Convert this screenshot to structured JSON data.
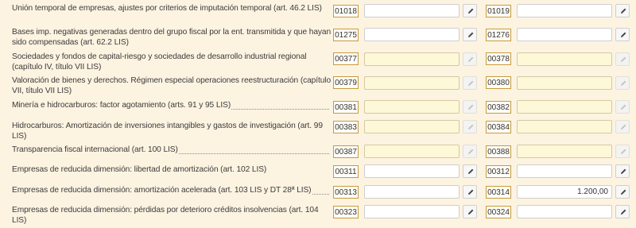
{
  "rows": [
    {
      "label": "Unión temporal de empresas, ajustes por criterios de imputación temporal (art. 46.2 LIS)",
      "code1": "01018",
      "value1": "",
      "code2": "01019",
      "value2": ""
    },
    {
      "label": "Bases imp. negativas generadas dentro del grupo fiscal por la ent. transmitida y que hayan sido compensadas (art. 62.2 LIS)",
      "code1": "01275",
      "value1": "",
      "code2": "01276",
      "value2": ""
    },
    {
      "label": "Sociedades y fondos de capital-riesgo y sociedades de desarrollo industrial regional (capítulo IV, título VII LIS)",
      "code1": "00377",
      "value1": "",
      "code2": "00378",
      "value2": ""
    },
    {
      "label": "Valoración de bienes y derechos. Régimen especial operaciones reestructuración (capítulo VII, título VII LIS)",
      "code1": "00379",
      "value1": "",
      "code2": "00380",
      "value2": ""
    },
    {
      "label": "Minería e hidrocarburos: factor agotamiento (arts. 91 y 95 LIS)",
      "code1": "00381",
      "value1": "",
      "code2": "00382",
      "value2": ""
    },
    {
      "label": "Hidrocarburos: Amortización de inversiones intangibles y gastos de investigación (art. 99 LIS)",
      "code1": "00383",
      "value1": "",
      "code2": "00384",
      "value2": ""
    },
    {
      "label": "Transparencia fiscal internacional (art. 100 LIS)",
      "code1": "00387",
      "value1": "",
      "code2": "00388",
      "value2": ""
    },
    {
      "label": "Empresas de reducida dimensión: libertad de amortización (art. 102 LIS)",
      "code1": "00311",
      "value1": "",
      "code2": "00312",
      "value2": ""
    },
    {
      "label": "Empresas de reducida dimensión: amortización acelerada (art. 103 LIS y DT 28ª LIS)",
      "code1": "00313",
      "value1": "",
      "code2": "00314",
      "value2": "1.200,00"
    },
    {
      "label": "Empresas de reducida dimensión: pérdidas por deterioro créditos insolvencias (art. 104 LIS)",
      "code1": "00323",
      "value1": "",
      "code2": "00324",
      "value2": ""
    }
  ],
  "icons": {
    "edit": "pencil-icon"
  },
  "colors": {
    "background": "#fdf3e1",
    "code_border": "#c79a3c",
    "field_white": "#ffffff",
    "field_yellow": "#fdf8d7"
  }
}
